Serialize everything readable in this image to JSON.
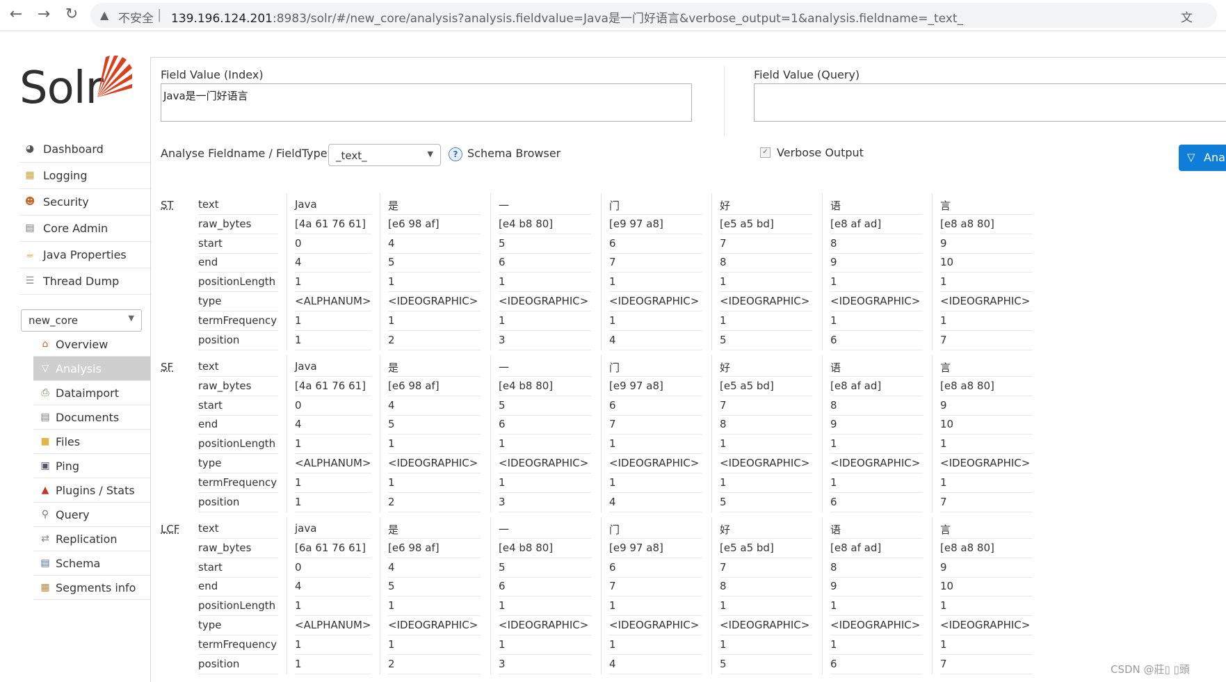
{
  "browser": {
    "insecure_label": "不安全",
    "separator": "|",
    "url_host": "139.196.124.201",
    "url_rest": ":8983/solr/#/new_core/analysis?analysis.fieldvalue=Java是一门好语言&verbose_output=1&analysis.fieldname=_text_",
    "back_icon": "back-arrow-icon",
    "forward_icon": "forward-arrow-icon",
    "reload_icon": "reload-icon"
  },
  "logo": {
    "text": "Solr"
  },
  "menu": [
    {
      "label": "Dashboard",
      "icon": "dashboard-icon"
    },
    {
      "label": "Logging",
      "icon": "logging-icon"
    },
    {
      "label": "Security",
      "icon": "security-icon"
    },
    {
      "label": "Core Admin",
      "icon": "core-admin-icon"
    },
    {
      "label": "Java Properties",
      "icon": "java-properties-icon"
    },
    {
      "label": "Thread Dump",
      "icon": "thread-dump-icon"
    }
  ],
  "core_selector": {
    "value": "new_core"
  },
  "core_menu": [
    {
      "label": "Overview",
      "icon": "overview-icon"
    },
    {
      "label": "Analysis",
      "icon": "analysis-icon",
      "active": true
    },
    {
      "label": "Dataimport",
      "icon": "dataimport-icon"
    },
    {
      "label": "Documents",
      "icon": "documents-icon"
    },
    {
      "label": "Files",
      "icon": "files-icon"
    },
    {
      "label": "Ping",
      "icon": "ping-icon"
    },
    {
      "label": "Plugins / Stats",
      "icon": "plugins-icon"
    },
    {
      "label": "Query",
      "icon": "query-icon"
    },
    {
      "label": "Replication",
      "icon": "replication-icon"
    },
    {
      "label": "Schema",
      "icon": "schema-icon"
    },
    {
      "label": "Segments info",
      "icon": "segments-icon"
    }
  ],
  "analysis": {
    "index_label": "Field Value (Index)",
    "index_value": "Java是一门好语言",
    "query_label": "Field Value (Query)",
    "query_value": "",
    "fieldname_label": "Analyse Fieldname / FieldType:",
    "fieldname_value": "_text_",
    "schema_browser": "Schema Browser",
    "verbose_label": "Verbose Output",
    "verbose_checked": true,
    "analyse_button": "Anal"
  },
  "attributes": [
    "text",
    "raw_bytes",
    "start",
    "end",
    "positionLength",
    "type",
    "termFrequency",
    "position"
  ],
  "stages": [
    {
      "abbr": "ST",
      "tokens": [
        [
          "Java",
          "[4a 61 76 61]",
          "0",
          "4",
          "1",
          "<ALPHANUM>",
          "1",
          "1"
        ],
        [
          "是",
          "[e6 98 af]",
          "4",
          "5",
          "1",
          "<IDEOGRAPHIC>",
          "1",
          "2"
        ],
        [
          "一",
          "[e4 b8 80]",
          "5",
          "6",
          "1",
          "<IDEOGRAPHIC>",
          "1",
          "3"
        ],
        [
          "门",
          "[e9 97 a8]",
          "6",
          "7",
          "1",
          "<IDEOGRAPHIC>",
          "1",
          "4"
        ],
        [
          "好",
          "[e5 a5 bd]",
          "7",
          "8",
          "1",
          "<IDEOGRAPHIC>",
          "1",
          "5"
        ],
        [
          "语",
          "[e8 af ad]",
          "8",
          "9",
          "1",
          "<IDEOGRAPHIC>",
          "1",
          "6"
        ],
        [
          "言",
          "[e8 a8 80]",
          "9",
          "10",
          "1",
          "<IDEOGRAPHIC>",
          "1",
          "7"
        ]
      ]
    },
    {
      "abbr": "SF",
      "tokens": [
        [
          "Java",
          "[4a 61 76 61]",
          "0",
          "4",
          "1",
          "<ALPHANUM>",
          "1",
          "1"
        ],
        [
          "是",
          "[e6 98 af]",
          "4",
          "5",
          "1",
          "<IDEOGRAPHIC>",
          "1",
          "2"
        ],
        [
          "一",
          "[e4 b8 80]",
          "5",
          "6",
          "1",
          "<IDEOGRAPHIC>",
          "1",
          "3"
        ],
        [
          "门",
          "[e9 97 a8]",
          "6",
          "7",
          "1",
          "<IDEOGRAPHIC>",
          "1",
          "4"
        ],
        [
          "好",
          "[e5 a5 bd]",
          "7",
          "8",
          "1",
          "<IDEOGRAPHIC>",
          "1",
          "5"
        ],
        [
          "语",
          "[e8 af ad]",
          "8",
          "9",
          "1",
          "<IDEOGRAPHIC>",
          "1",
          "6"
        ],
        [
          "言",
          "[e8 a8 80]",
          "9",
          "10",
          "1",
          "<IDEOGRAPHIC>",
          "1",
          "7"
        ]
      ]
    },
    {
      "abbr": "LCF",
      "tokens": [
        [
          "java",
          "[6a 61 76 61]",
          "0",
          "4",
          "1",
          "<ALPHANUM>",
          "1",
          "1"
        ],
        [
          "是",
          "[e6 98 af]",
          "4",
          "5",
          "1",
          "<IDEOGRAPHIC>",
          "1",
          "2"
        ],
        [
          "一",
          "[e4 b8 80]",
          "5",
          "6",
          "1",
          "<IDEOGRAPHIC>",
          "1",
          "3"
        ],
        [
          "门",
          "[e9 97 a8]",
          "6",
          "7",
          "1",
          "<IDEOGRAPHIC>",
          "1",
          "4"
        ],
        [
          "好",
          "[e5 a5 bd]",
          "7",
          "8",
          "1",
          "<IDEOGRAPHIC>",
          "1",
          "5"
        ],
        [
          "语",
          "[e8 af ad]",
          "8",
          "9",
          "1",
          "<IDEOGRAPHIC>",
          "1",
          "6"
        ],
        [
          "言",
          "[e8 a8 80]",
          "9",
          "10",
          "1",
          "<IDEOGRAPHIC>",
          "1",
          "7"
        ]
      ]
    }
  ],
  "watermark": "CSDN @莊▯ ▯頭",
  "colors": {
    "accent": "#0f7ed8",
    "logo_red": "#d9411e",
    "active_menu_bg": "#cfcfcf"
  }
}
